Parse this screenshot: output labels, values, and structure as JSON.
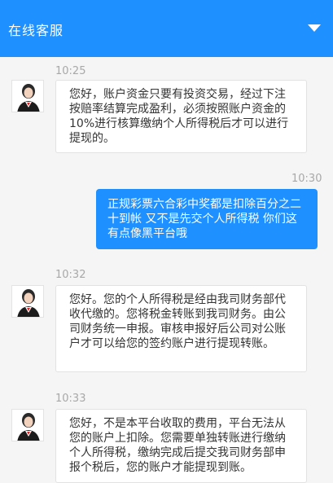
{
  "header": {
    "title": "在线客服"
  },
  "messages": [
    {
      "time": "10:25",
      "text": "您好，账户资金只要有投资交易，经过下注按赔率结算完成盈利，必须按照账户资金的10%进行核算缴纳个人所得税后才可以进行提现的。"
    },
    {
      "time": "10:30",
      "text": "正规彩票六合彩中奖都是扣除百分之二十到帐 又不是先交个人所得税 你们这有点像黑平台哦"
    },
    {
      "time": "10:32",
      "text": "您好。您的个人所得税是经由我司财务部代收代缴的。您将税金转账到我司财务。由公司财务统一申报。审核申报好后公司对公账户才可以给您的签约账户进行提现转账。"
    },
    {
      "time": "10:33",
      "text": "您好，不是本平台收取的费用，平台无法从您的账户上扣除。您需要单独转账进行缴纳个人所得税，缴纳完成后提交我司财务部申报个税后，您的账户才能提现到账。"
    }
  ]
}
